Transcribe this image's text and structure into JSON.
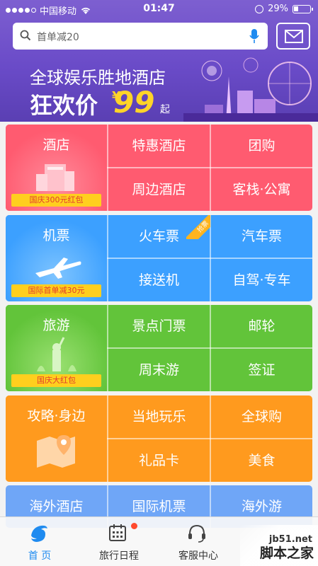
{
  "status_bar": {
    "carrier": "中国移动",
    "time": "01:47",
    "battery": "29%"
  },
  "search": {
    "placeholder": "首单减20"
  },
  "banner": {
    "line1": "全球娱乐胜地酒店",
    "line2": "狂欢价",
    "currency": "¥",
    "price": "99",
    "suffix": "起"
  },
  "grid": {
    "hotel": {
      "title": "酒店",
      "badge": "国庆300元红包",
      "cells": [
        "特惠酒店",
        "团购",
        "周边酒店",
        "客栈·公寓"
      ],
      "color": "#ff5b70"
    },
    "flight": {
      "title": "机票",
      "badge": "国际首单减30元",
      "cells": [
        "火车票",
        "汽车票",
        "接送机",
        "自驾·专车"
      ],
      "ribbon": "抢票",
      "color": "#3ca0ff"
    },
    "travel": {
      "title": "旅游",
      "badge": "国庆大红包",
      "cells": [
        "景点门票",
        "邮轮",
        "周末游",
        "签证"
      ],
      "color": "#62c43a"
    },
    "guide": {
      "title": "攻略·身边",
      "cells": [
        "当地玩乐",
        "全球购",
        "礼品卡",
        "美食"
      ],
      "color": "#ff9a1e"
    },
    "overseas": {
      "cells": [
        "海外酒店",
        "国际机票",
        "海外游"
      ],
      "color": "#6fa6f7"
    }
  },
  "tabbar": {
    "tabs": [
      {
        "label": "首 页",
        "icon": "dolphin-icon",
        "active": true
      },
      {
        "label": "旅行日程",
        "icon": "calendar-icon"
      },
      {
        "label": "客服中心",
        "icon": "headset-icon"
      }
    ]
  },
  "watermark": {
    "site": "jb51.net",
    "name": "脚本之家"
  }
}
